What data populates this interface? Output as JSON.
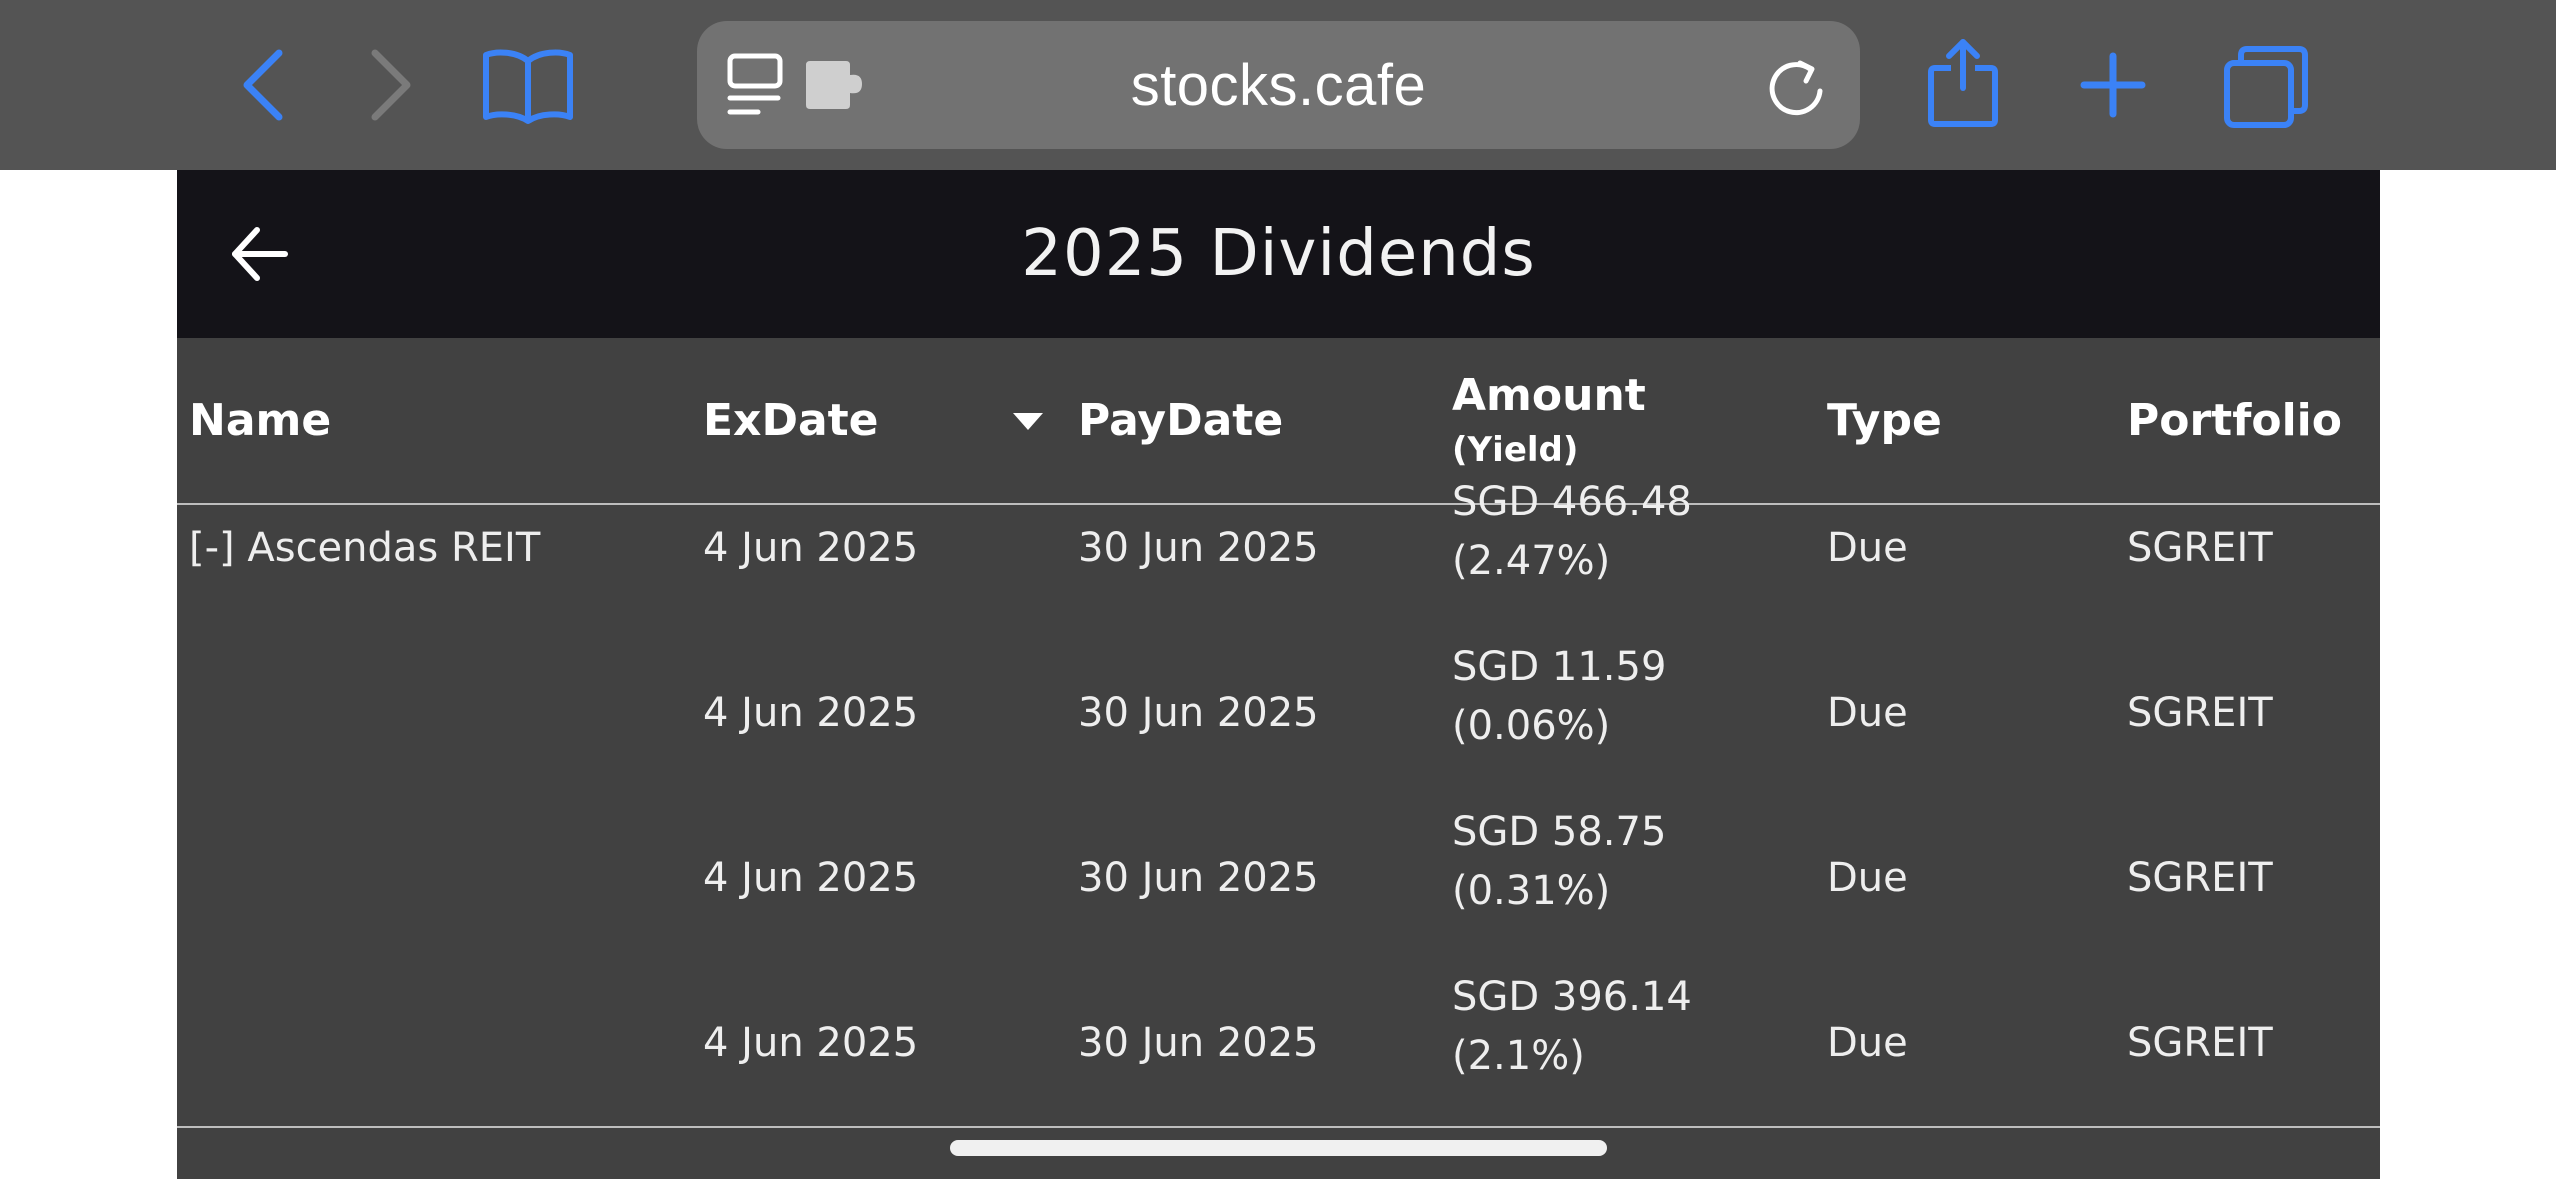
{
  "browser": {
    "url": "stocks.cafe",
    "colors": {
      "toolbar_bg": "#545454",
      "accent": "#3b82f6",
      "disabled": "#7a7a7a",
      "url_pill": "#727272"
    }
  },
  "app": {
    "title": "2025 Dividends",
    "colors": {
      "header_bg": "#141318",
      "table_bg": "#414141",
      "text": "#eeeeee"
    }
  },
  "table": {
    "headers": {
      "name": "Name",
      "exdate": "ExDate",
      "paydate": "PayDate",
      "amount": "Amount",
      "amount_sub": "(Yield)",
      "type": "Type",
      "portfolio": "Portfolio"
    },
    "sort": {
      "column": "ExDate",
      "direction": "descending"
    },
    "rows": [
      {
        "name": "[-] Ascendas REIT",
        "exdate": "4 Jun 2025",
        "paydate": "30 Jun 2025",
        "amount": "SGD 466.48",
        "yield": "(2.47%)",
        "type": "Due",
        "portfolio": "SGREIT"
      },
      {
        "name": "",
        "exdate": "4 Jun 2025",
        "paydate": "30 Jun 2025",
        "amount": "SGD 11.59",
        "yield": "(0.06%)",
        "type": "Due",
        "portfolio": "SGREIT"
      },
      {
        "name": "",
        "exdate": "4 Jun 2025",
        "paydate": "30 Jun 2025",
        "amount": "SGD 58.75",
        "yield": "(0.31%)",
        "type": "Due",
        "portfolio": "SGREIT"
      },
      {
        "name": "",
        "exdate": "4 Jun 2025",
        "paydate": "30 Jun 2025",
        "amount": "SGD 396.14",
        "yield": "(2.1%)",
        "type": "Due",
        "portfolio": "SGREIT"
      }
    ]
  },
  "icons": {
    "back": "chevron-left-icon",
    "forward": "chevron-right-icon",
    "bookmarks": "book-icon",
    "reader": "reader-icon",
    "extension": "puzzle-icon",
    "reload": "reload-icon",
    "share": "share-icon",
    "new_tab": "plus-icon",
    "tabs": "tabs-icon",
    "app_back": "arrow-left-icon"
  }
}
